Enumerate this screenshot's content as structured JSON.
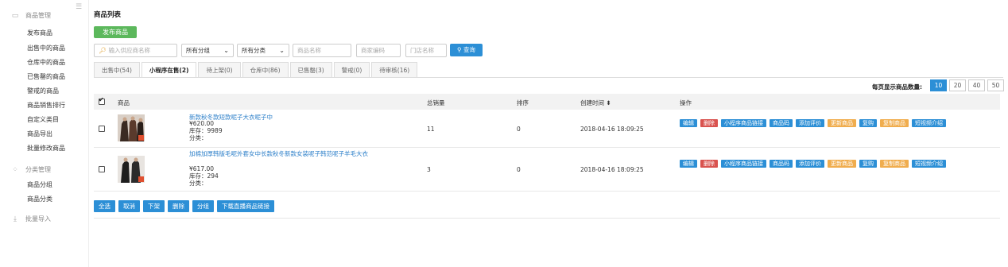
{
  "sidebar": {
    "groups": [
      {
        "label": "商品管理",
        "icon": "package-icon"
      },
      {
        "label": "分类管理",
        "icon": "grid-icon"
      },
      {
        "label": "批量导入",
        "icon": "import-icon"
      }
    ],
    "goods_items": [
      "发布商品",
      "出售中的商品",
      "仓库中的商品",
      "已售罄的商品",
      "警戒的商品",
      "商品销售排行",
      "自定义类目",
      "商品导出",
      "批量修改商品"
    ],
    "category_items": [
      "商品分组",
      "商品分类"
    ]
  },
  "main": {
    "title": "商品列表",
    "publish_label": "发布商品",
    "filters": {
      "supplier_placeholder": "输入供应商名称",
      "group_select": "所有分组",
      "category_select": "所有分类",
      "name_placeholder": "商品名称",
      "code_placeholder": "商家编码",
      "store_placeholder": "门店名称",
      "query_label": "查询"
    },
    "tabs": [
      "出售中(54)",
      "小程序在售(2)",
      "待上架(0)",
      "仓库中(86)",
      "已售罄(3)",
      "警戒(0)",
      "待审核(16)"
    ],
    "active_tab": 1,
    "per_page": {
      "label": "每页显示商品数量:",
      "options": [
        "10",
        "20",
        "40",
        "50"
      ],
      "selected": "10"
    },
    "columns": {
      "product": "商品",
      "sales": "总销量",
      "sort": "排序",
      "created": "创建时间 ⬍",
      "actions": "操作"
    },
    "rows": [
      {
        "name": "新款秋冬款短款呢子大衣呢子中",
        "price": "¥620.00",
        "stock": "库存：9989",
        "category": "分类：",
        "sales": "11",
        "sort": "0",
        "created": "2018-04-16 18:09:25"
      },
      {
        "name": "加棉加厚韩版毛呢外套女中长款秋冬新款女装呢子韩范呢子羊毛大衣",
        "price": "¥617.00",
        "stock": "库存：294",
        "category": "分类：",
        "sales": "3",
        "sort": "0",
        "created": "2018-04-16 18:09:25"
      }
    ],
    "actions": [
      {
        "label": "编辑",
        "color": "#2c8fd6"
      },
      {
        "label": "删除",
        "color": "#d9534f"
      },
      {
        "label": "小程序商品链接",
        "color": "#2c8fd6"
      },
      {
        "label": "商品码",
        "color": "#2c8fd6"
      },
      {
        "label": "添加评价",
        "color": "#2c8fd6"
      },
      {
        "label": "更新商品",
        "color": "#f0ad4e"
      },
      {
        "label": "复购",
        "color": "#2c8fd6"
      },
      {
        "label": "复制商品",
        "color": "#f0ad4e"
      },
      {
        "label": "短视频介绍",
        "color": "#2c8fd6"
      }
    ],
    "bottom_buttons": [
      "全选",
      "取消",
      "下架",
      "删除",
      "分组",
      "下载直播商品链接"
    ]
  }
}
